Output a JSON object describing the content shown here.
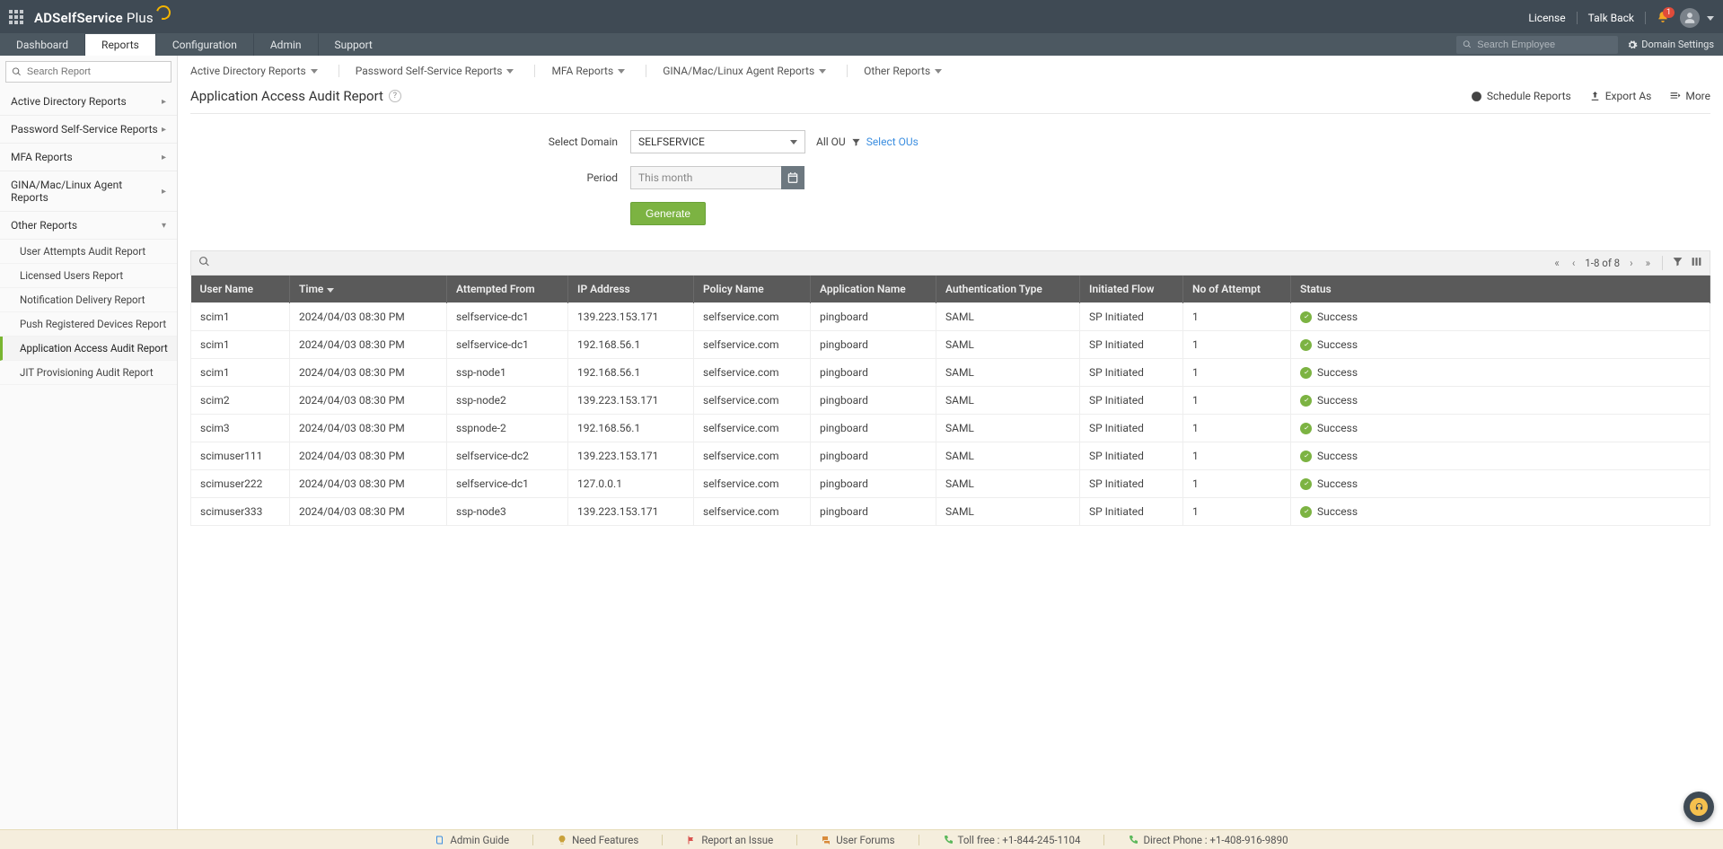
{
  "header": {
    "product_name": "ADSelfService",
    "product_suffix": "Plus",
    "license_label": "License",
    "talkback_label": "Talk Back",
    "notification_count": "1",
    "search_placeholder": "Search Employee",
    "domain_settings_label": "Domain Settings"
  },
  "tabs": {
    "dashboard": "Dashboard",
    "reports": "Reports",
    "configuration": "Configuration",
    "admin": "Admin",
    "support": "Support"
  },
  "sidebar": {
    "search_placeholder": "Search Report",
    "categories": {
      "ad": "Active Directory Reports",
      "pwd": "Password Self-Service Reports",
      "mfa": "MFA Reports",
      "gina": "GINA/Mac/Linux Agent Reports",
      "other": "Other Reports"
    },
    "other_items": {
      "user_attempts": "User Attempts Audit Report",
      "licensed": "Licensed Users Report",
      "notification": "Notification Delivery Report",
      "push": "Push Registered Devices Report",
      "app_access": "Application Access Audit Report",
      "jit": "JIT Provisioning Audit Report"
    }
  },
  "subnav": {
    "ad": "Active Directory Reports",
    "pwd": "Password Self-Service Reports",
    "mfa": "MFA Reports",
    "gina": "GINA/Mac/Linux Agent Reports",
    "other": "Other Reports"
  },
  "page": {
    "title": "Application Access Audit Report",
    "schedule": "Schedule Reports",
    "export": "Export As",
    "more": "More"
  },
  "filters": {
    "domain_label": "Select Domain",
    "domain_value": "SELFSERVICE",
    "all_ou": "All OU",
    "select_ous": "Select OUs",
    "period_label": "Period",
    "period_value": "This month",
    "generate": "Generate"
  },
  "pager": {
    "range": "1-8 of 8"
  },
  "columns": {
    "user": "User Name",
    "time": "Time",
    "from": "Attempted From",
    "ip": "IP Address",
    "policy": "Policy Name",
    "app": "Application Name",
    "auth": "Authentication Type",
    "flow": "Initiated Flow",
    "attempt": "No of Attempt",
    "status": "Status"
  },
  "rows": [
    {
      "user": "scim1",
      "time": "2024/04/03 08:30 PM",
      "from": "selfservice-dc1",
      "ip": "139.223.153.171",
      "policy": "selfservice.com",
      "app": "pingboard",
      "auth": "SAML",
      "flow": "SP Initiated",
      "attempt": "1",
      "status": "Success"
    },
    {
      "user": "scim1",
      "time": "2024/04/03 08:30 PM",
      "from": "selfservice-dc1",
      "ip": "192.168.56.1",
      "policy": "selfservice.com",
      "app": "pingboard",
      "auth": "SAML",
      "flow": "SP Initiated",
      "attempt": "1",
      "status": "Success"
    },
    {
      "user": "scim1",
      "time": "2024/04/03 08:30 PM",
      "from": "ssp-node1",
      "ip": "192.168.56.1",
      "policy": "selfservice.com",
      "app": "pingboard",
      "auth": "SAML",
      "flow": "SP Initiated",
      "attempt": "1",
      "status": "Success"
    },
    {
      "user": "scim2",
      "time": "2024/04/03 08:30 PM",
      "from": "ssp-node2",
      "ip": "139.223.153.171",
      "policy": "selfservice.com",
      "app": "pingboard",
      "auth": "SAML",
      "flow": "SP Initiated",
      "attempt": "1",
      "status": "Success"
    },
    {
      "user": "scim3",
      "time": "2024/04/03 08:30 PM",
      "from": "sspnode-2",
      "ip": "192.168.56.1",
      "policy": "selfservice.com",
      "app": "pingboard",
      "auth": "SAML",
      "flow": "SP Initiated",
      "attempt": "1",
      "status": "Success"
    },
    {
      "user": "scimuser111",
      "time": "2024/04/03 08:30 PM",
      "from": "selfservice-dc2",
      "ip": "139.223.153.171",
      "policy": "selfservice.com",
      "app": "pingboard",
      "auth": "SAML",
      "flow": "SP Initiated",
      "attempt": "1",
      "status": "Success"
    },
    {
      "user": "scimuser222",
      "time": "2024/04/03 08:30 PM",
      "from": "selfservice-dc1",
      "ip": "127.0.0.1",
      "policy": "selfservice.com",
      "app": "pingboard",
      "auth": "SAML",
      "flow": "SP Initiated",
      "attempt": "1",
      "status": "Success"
    },
    {
      "user": "scimuser333",
      "time": "2024/04/03 08:30 PM",
      "from": "ssp-node3",
      "ip": "139.223.153.171",
      "policy": "selfservice.com",
      "app": "pingboard",
      "auth": "SAML",
      "flow": "SP Initiated",
      "attempt": "1",
      "status": "Success"
    }
  ],
  "footer": {
    "admin_guide": "Admin Guide",
    "need_features": "Need Features",
    "report_issue": "Report an Issue",
    "user_forums": "User Forums",
    "toll_free": "Toll free : +1-844-245-1104",
    "direct": "Direct Phone : +1-408-916-9890"
  }
}
